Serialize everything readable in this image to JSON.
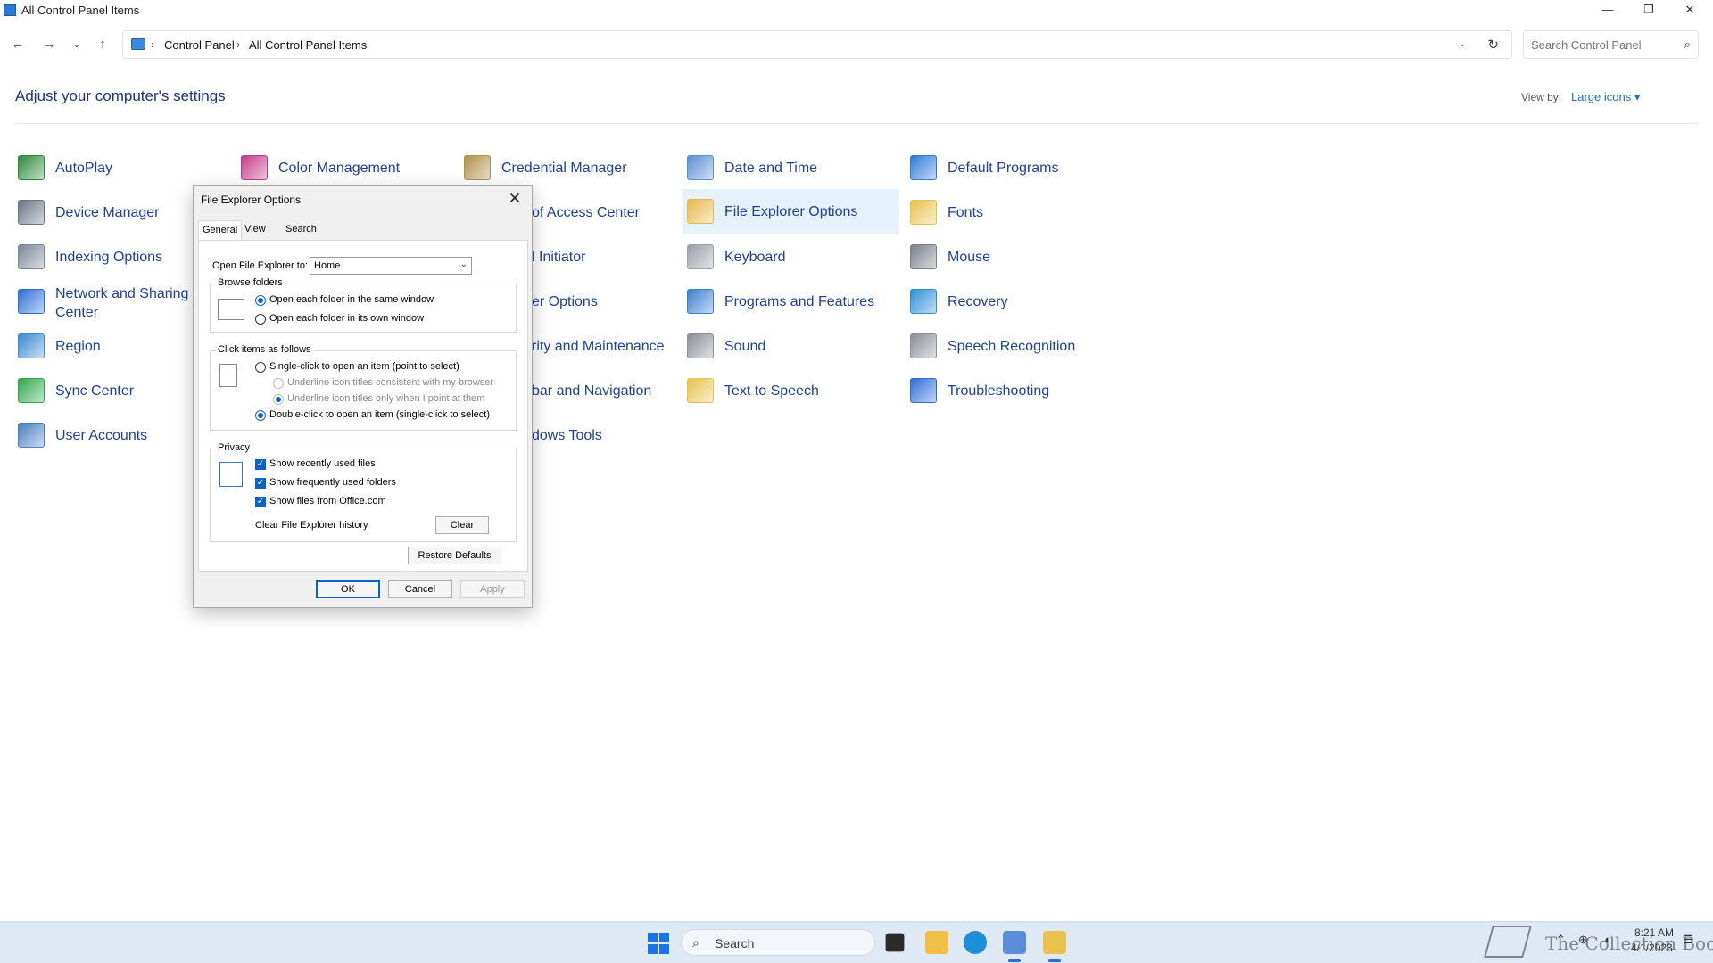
{
  "window": {
    "title": "All Control Panel Items",
    "minimize_icon": "minimize-icon",
    "maximize_icon": "restore-icon",
    "close_icon": "close-icon"
  },
  "nav": {
    "back_icon": "back-arrow-icon",
    "forward_icon": "forward-arrow-icon",
    "recent_icon": "chevron-down-icon",
    "up_icon": "up-arrow-icon",
    "breadcrumb": [
      "Control Panel",
      "All Control Panel Items"
    ],
    "search_placeholder": "Search Control Panel"
  },
  "header": {
    "title": "Adjust your computer's settings",
    "view_by_label": "View by:",
    "view_by_value": "Large icons",
    "view_by_arrow": "▾"
  },
  "items": [
    {
      "label": "AutoPlay",
      "icon": "autoplay-icon",
      "color": "#2e8b3a"
    },
    {
      "label": "Color Management",
      "icon": "color-management-icon",
      "color": "#c23b8a"
    },
    {
      "label": "Credential Manager",
      "icon": "credential-manager-icon",
      "color": "#b0904a"
    },
    {
      "label": "Date and Time",
      "icon": "date-time-icon",
      "color": "#5a8fd0"
    },
    {
      "label": "Default Programs",
      "icon": "default-programs-icon",
      "color": "#2d7bd6"
    },
    {
      "label": "Device Manager",
      "icon": "device-manager-icon",
      "color": "#6a7585"
    },
    {
      "label": "of Access Center",
      "icon": "ease-of-access-icon",
      "color": "#2d7bd6"
    },
    {
      "label": "File Explorer Options",
      "icon": "folder-options-icon",
      "color": "#e8b84a"
    },
    {
      "label": "Fonts",
      "icon": "fonts-icon",
      "color": "#e8c24a"
    },
    {
      "label": "Indexing Options",
      "icon": "indexing-options-icon",
      "color": "#7a8798"
    },
    {
      "label": "l Initiator",
      "icon": "iscsi-initiator-icon",
      "color": "#6a7585"
    },
    {
      "label": "Keyboard",
      "icon": "keyboard-icon",
      "color": "#9aa0a8"
    },
    {
      "label": "Mouse",
      "icon": "mouse-icon",
      "color": "#7a8088"
    },
    {
      "label": "Network and Sharing Center",
      "icon": "network-sharing-icon",
      "color": "#2d6ed6"
    },
    {
      "label": "er Options",
      "icon": "power-options-icon",
      "color": "#3a9a4a"
    },
    {
      "label": "Programs and Features",
      "icon": "programs-features-icon",
      "color": "#3a7fd0"
    },
    {
      "label": "Recovery",
      "icon": "recovery-icon",
      "color": "#2d8fd6"
    },
    {
      "label": "Region",
      "icon": "region-icon",
      "color": "#3a8ad0"
    },
    {
      "label": "rity and Maintenance",
      "icon": "security-maintenance-icon",
      "color": "#2d6ed6"
    },
    {
      "label": "Sound",
      "icon": "sound-icon",
      "color": "#8a9098"
    },
    {
      "label": "Speech Recognition",
      "icon": "speech-recognition-icon",
      "color": "#8a9098"
    },
    {
      "label": "Sync Center",
      "icon": "sync-center-icon",
      "color": "#2fa84a"
    },
    {
      "label": "bar and Navigation",
      "icon": "taskbar-navigation-icon",
      "color": "#6a7585"
    },
    {
      "label": "Text to Speech",
      "icon": "text-to-speech-icon",
      "color": "#e8c24a"
    },
    {
      "label": "Troubleshooting",
      "icon": "troubleshooting-icon",
      "color": "#2d6ed6"
    },
    {
      "label": "User Accounts",
      "icon": "user-accounts-icon",
      "color": "#4a7fc0"
    },
    {
      "label": "dows Tools",
      "icon": "windows-tools-icon",
      "color": "#6a7585"
    }
  ],
  "dialog": {
    "title": "File Explorer Options",
    "tabs": [
      "General",
      "View",
      "Search"
    ],
    "open_to_label": "Open File Explorer to:",
    "open_to_value": "Home",
    "browse_folders": {
      "title": "Browse folders",
      "opt1": "Open each folder in the same window",
      "opt2": "Open each folder in its own window"
    },
    "click_items": {
      "title": "Click items as follows",
      "opt1": "Single-click to open an item (point to select)",
      "sub1": "Underline icon titles consistent with my browser",
      "sub2": "Underline icon titles only when I point at them",
      "opt2": "Double-click to open an item (single-click to select)"
    },
    "privacy": {
      "title": "Privacy",
      "c1": "Show recently used files",
      "c2": "Show frequently used folders",
      "c3": "Show files from Office.com",
      "clear_label": "Clear File Explorer history",
      "clear_button": "Clear"
    },
    "restore_defaults": "Restore Defaults",
    "ok": "OK",
    "cancel": "Cancel",
    "apply": "Apply"
  },
  "taskbar": {
    "search_label": "Search",
    "time": "8:21 AM",
    "date": "4/1/2023",
    "watermark": "The Collection Book"
  }
}
